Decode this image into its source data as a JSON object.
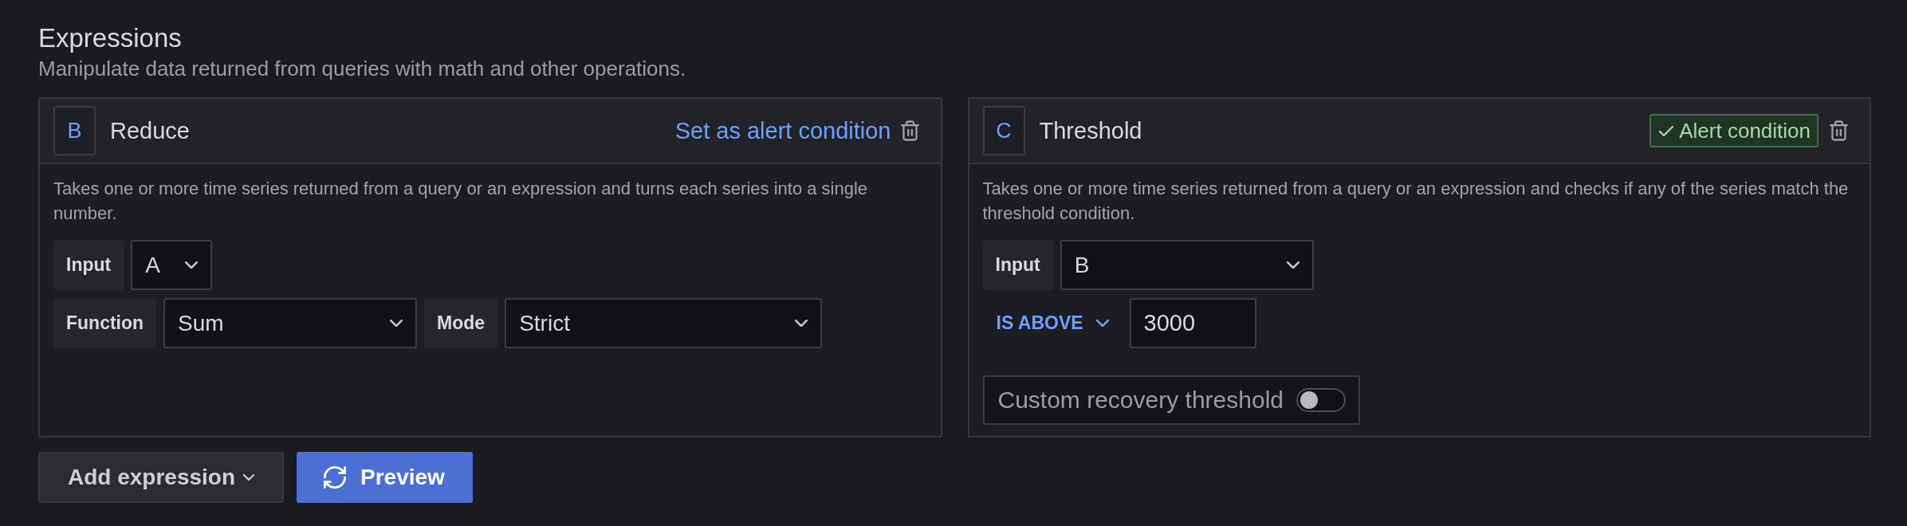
{
  "header": {
    "title": "Expressions",
    "description": "Manipulate data returned from queries with math and other operations."
  },
  "expressions": [
    {
      "kind": "reduce",
      "ref": "B",
      "title": "Reduce",
      "is_alert_condition": false,
      "condition_label": "Set as alert condition",
      "description": "Takes one or more time series returned from a query or an expression and turns each series into a single number.",
      "rows": [
        [
          {
            "kind": "select",
            "label": "Input",
            "value": "A"
          }
        ],
        [
          {
            "kind": "select",
            "label": "Function",
            "value": "Sum"
          },
          {
            "kind": "select",
            "label": "Mode",
            "value": "Strict"
          }
        ]
      ]
    },
    {
      "kind": "threshold",
      "ref": "C",
      "title": "Threshold",
      "is_alert_condition": true,
      "condition_label": "Alert condition",
      "description": "Takes one or more time series returned from a query or an expression and checks if any of the series match the threshold condition.",
      "rows": [
        [
          {
            "kind": "select",
            "label": "Input",
            "value": "B"
          }
        ],
        [
          {
            "kind": "operator",
            "value": "IS ABOVE"
          },
          {
            "kind": "number",
            "value": "3000"
          }
        ],
        [
          {
            "kind": "switch",
            "label": "Custom recovery threshold",
            "on": false
          }
        ]
      ]
    }
  ],
  "actions": {
    "add_expression": "Add expression",
    "preview": "Preview"
  }
}
